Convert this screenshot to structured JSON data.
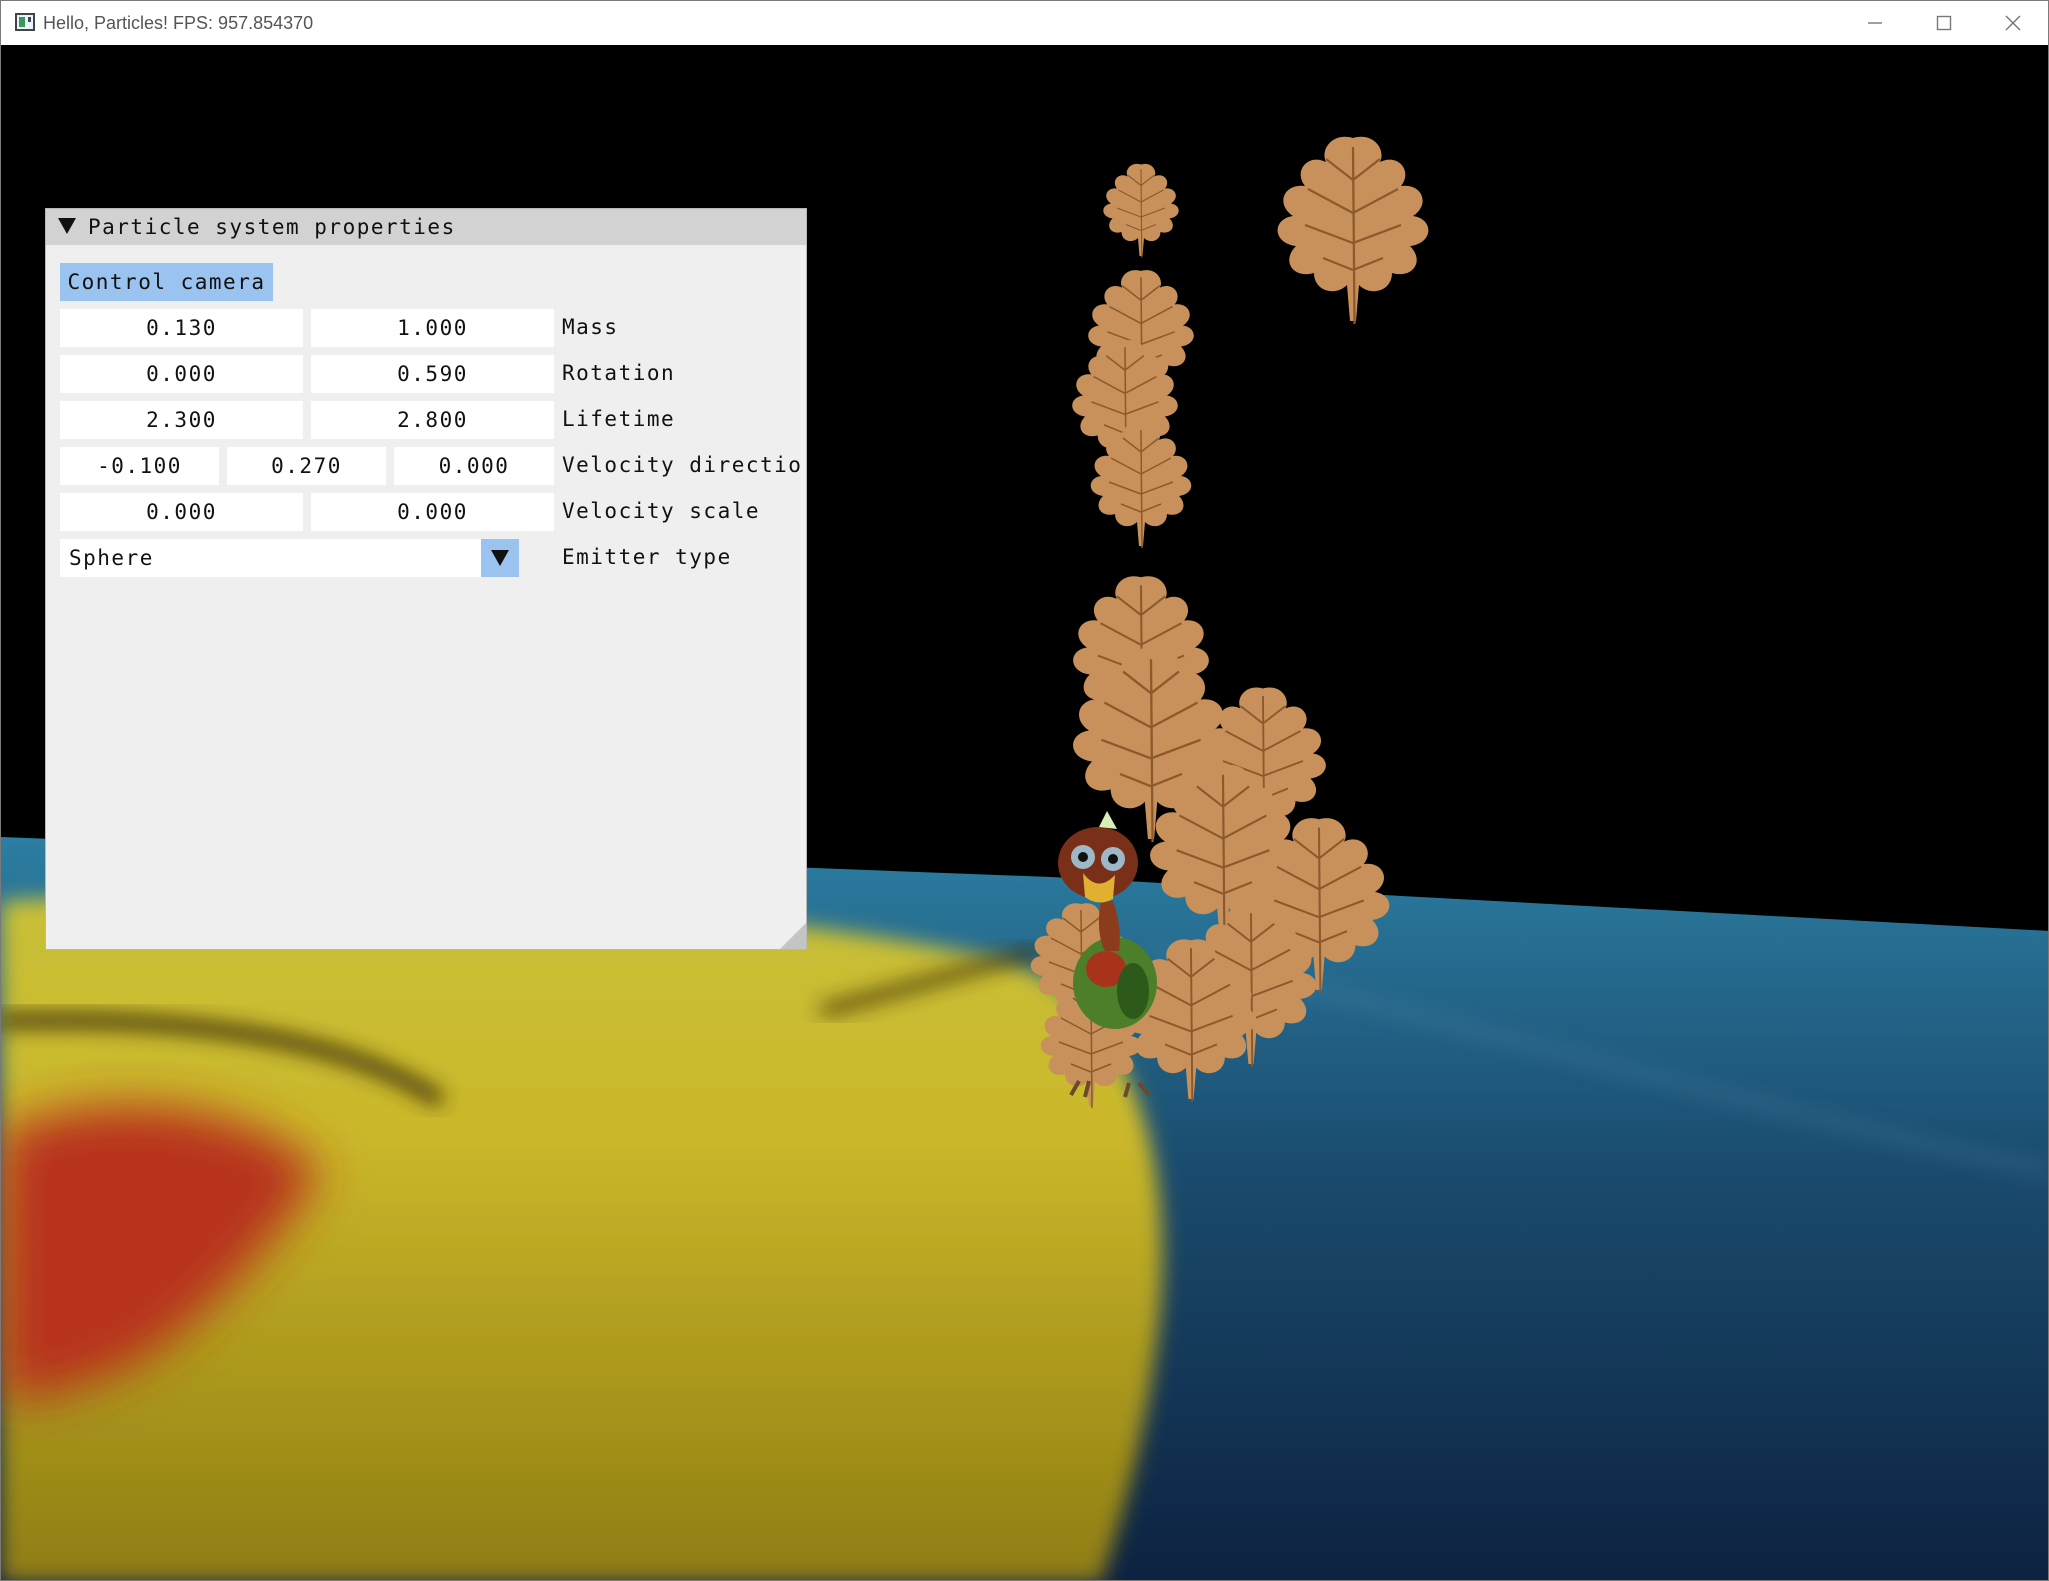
{
  "window": {
    "title": "Hello, Particles! FPS: 957.854370"
  },
  "panel": {
    "title": "Particle system properties",
    "control_camera_label": "Control camera",
    "rows": [
      {
        "values": [
          "0.130",
          "1.000"
        ],
        "label": "Mass"
      },
      {
        "values": [
          "0.000",
          "0.590"
        ],
        "label": "Rotation"
      },
      {
        "values": [
          "2.300",
          "2.800"
        ],
        "label": "Lifetime"
      },
      {
        "values": [
          "-0.100",
          "0.270",
          "0.000"
        ],
        "label": "Velocity directio"
      },
      {
        "values": [
          "0.000",
          "0.000"
        ],
        "label": "Velocity scale"
      }
    ],
    "emitter": {
      "value": "Sphere",
      "label": "Emitter type"
    }
  },
  "colors": {
    "panel_bg": "#efefef",
    "panel_header": "#d2d2d2",
    "accent": "#9ac3f0",
    "leaf": "#c8915b",
    "leaf_vein": "#8a5a2c"
  }
}
